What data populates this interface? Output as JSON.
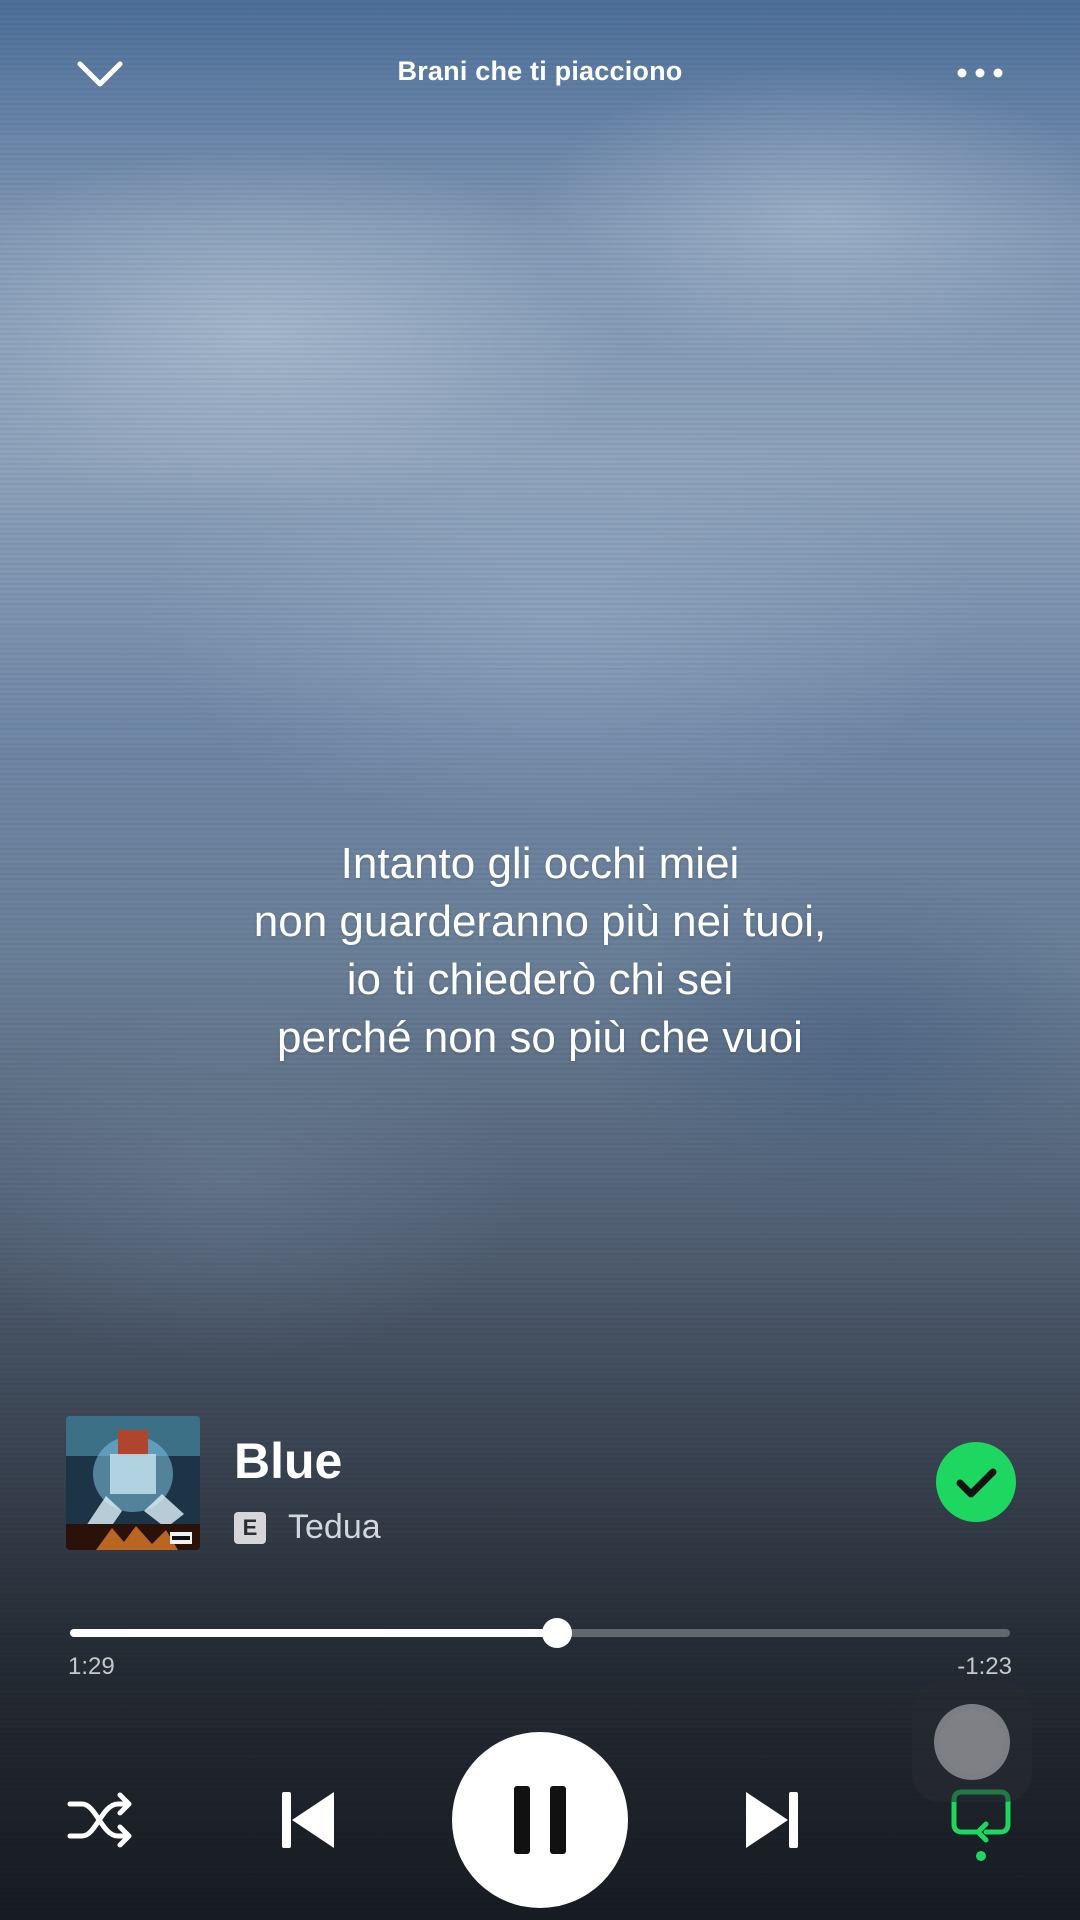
{
  "header": {
    "title": "Brani che ti piacciono",
    "collapse_icon": "chevron-down-icon",
    "more_icon": "more-horizontal-icon"
  },
  "lyrics": {
    "lines": [
      "Intanto gli occhi miei",
      "non guarderanno più nei tuoi,",
      "io ti chiederò chi sei",
      "perché non so più che vuoi"
    ]
  },
  "track": {
    "title": "Blue",
    "explicit_badge": "E",
    "artist": "Tedua",
    "liked": true,
    "liked_icon": "check-icon"
  },
  "playback": {
    "elapsed": "1:29",
    "remaining": "-1:23",
    "progress_fraction": 0.518,
    "is_playing": true,
    "shuffle": false,
    "repeat": true
  },
  "colors": {
    "accent_green": "#1ed760",
    "text_primary": "#ffffff",
    "text_secondary": "#c4c8cf"
  }
}
